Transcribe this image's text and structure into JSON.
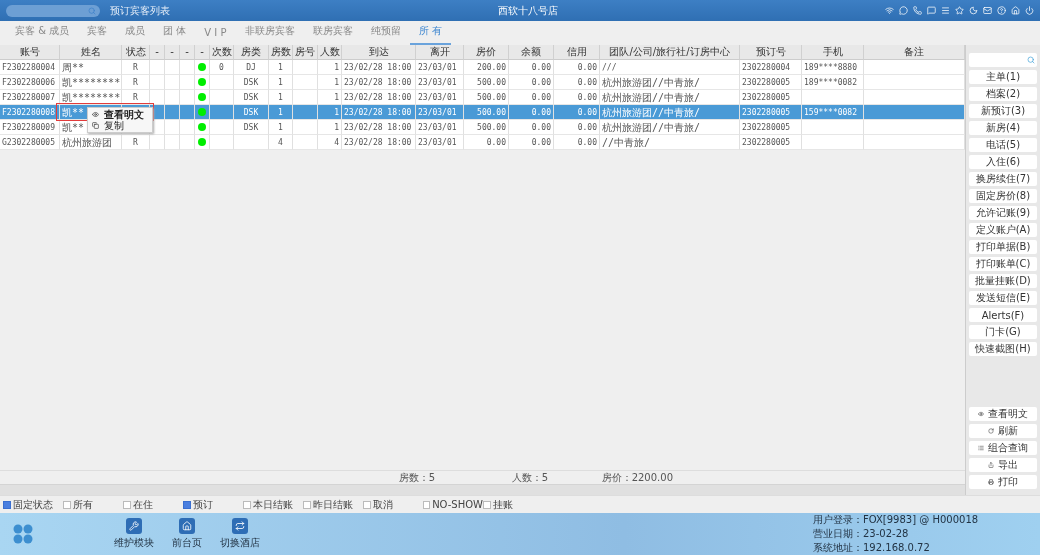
{
  "top_bar": {
    "page_title": "预订宾客列表",
    "hotel": "西软十八号店"
  },
  "tabs": [
    {
      "label": "宾客 & 成员",
      "selected": false
    },
    {
      "label": "宾客",
      "selected": false
    },
    {
      "label": "成员",
      "selected": false
    },
    {
      "label": "团 体",
      "selected": false
    },
    {
      "label": "V I P",
      "selected": false
    },
    {
      "label": "非联房宾客",
      "selected": false
    },
    {
      "label": "联房宾客",
      "selected": false
    },
    {
      "label": "纯预留",
      "selected": false
    },
    {
      "label": "所 有",
      "selected": true
    }
  ],
  "table": {
    "columns": [
      {
        "label": "账号",
        "kind": "text"
      },
      {
        "label": "姓名",
        "kind": "text"
      },
      {
        "label": "状态",
        "kind": "center"
      },
      {
        "label": "-",
        "kind": "center"
      },
      {
        "label": "-",
        "kind": "center"
      },
      {
        "label": "-",
        "kind": "center"
      },
      {
        "label": "-",
        "kind": "dot"
      },
      {
        "label": "次数",
        "kind": "center"
      },
      {
        "label": "房类",
        "kind": "center"
      },
      {
        "label": "房数",
        "kind": "center"
      },
      {
        "label": "房号",
        "kind": "center"
      },
      {
        "label": "人数",
        "kind": "right"
      },
      {
        "label": "到达",
        "kind": "text"
      },
      {
        "label": "离开",
        "kind": "text"
      },
      {
        "label": "房价",
        "kind": "right"
      },
      {
        "label": "余额",
        "kind": "right"
      },
      {
        "label": "信用",
        "kind": "right"
      },
      {
        "label": "团队/公司/旅行社/订房中心",
        "kind": "text"
      },
      {
        "label": "预订号",
        "kind": "text"
      },
      {
        "label": "手机",
        "kind": "text"
      },
      {
        "label": "备注",
        "kind": "text"
      }
    ],
    "rows": [
      {
        "selected": false,
        "color": "#00ee00",
        "cells": [
          "F2302280004",
          "周**",
          "R",
          null,
          null,
          null,
          null,
          "0",
          "DJ",
          "1",
          null,
          "1",
          "23/02/28 18:00",
          "23/03/01",
          "200.00",
          "0.00",
          "0.00",
          "///",
          "2302280004",
          "189****8880",
          null
        ]
      },
      {
        "selected": false,
        "color": "#00ee00",
        "cells": [
          "F2302280006",
          "凯********",
          "R",
          null,
          null,
          null,
          null,
          null,
          "DSK",
          "1",
          null,
          "1",
          "23/02/28 18:00",
          "23/03/01",
          "500.00",
          "0.00",
          "0.00",
          "杭州旅游团//中青旅/",
          "2302280005",
          "189****0082",
          null
        ]
      },
      {
        "selected": false,
        "color": "#00ee00",
        "cells": [
          "F2302280007",
          "凯********",
          "R",
          null,
          null,
          null,
          null,
          null,
          "DSK",
          "1",
          null,
          "1",
          "23/02/28 18:00",
          "23/03/01",
          "500.00",
          "0.00",
          "0.00",
          "杭州旅游团//中青旅/",
          "2302280005",
          null,
          null
        ]
      },
      {
        "selected": true,
        "color": "#00ee00",
        "cells": [
          "F2302280008",
          "凯**",
          null,
          null,
          null,
          null,
          null,
          null,
          "DSK",
          "1",
          null,
          "1",
          "23/02/28 18:00",
          "23/03/01",
          "500.00",
          "0.00",
          "0.00",
          "杭州旅游团//中青旅/",
          "2302280005",
          "159****0082",
          null
        ]
      },
      {
        "selected": false,
        "color": "#00ee00",
        "cells": [
          "F2302280009",
          "凯**",
          null,
          null,
          null,
          null,
          null,
          null,
          "DSK",
          "1",
          null,
          "1",
          "23/02/28 18:00",
          "23/03/01",
          "500.00",
          "0.00",
          "0.00",
          "杭州旅游团//中青旅/",
          "2302280005",
          null,
          null
        ]
      },
      {
        "selected": false,
        "color": "#00ee00",
        "cells": [
          "G2302280005",
          "杭州旅游团",
          "R",
          null,
          null,
          null,
          null,
          null,
          null,
          "4",
          null,
          "4",
          "23/02/28 18:00",
          "23/03/01",
          "0.00",
          "0.00",
          "0.00",
          "//中青旅/",
          "2302280005",
          null,
          null
        ]
      }
    ],
    "context_menu": [
      {
        "label": "查看明文",
        "selected": true
      },
      {
        "label": "复制",
        "selected": false
      }
    ],
    "summary": {
      "rooms": "房数：5",
      "people": "人数：5",
      "rate": "房价：2200.00"
    }
  },
  "side_buttons": [
    "主单(1)",
    "档案(2)",
    "新预订(3)",
    "新房(4)",
    "电话(5)",
    "入住(6)",
    "换房续住(7)",
    "固定房价(8)",
    "允许记账(9)",
    "定义账户(A)",
    "打印单据(B)",
    "打印账单(C)",
    "批量挂账(D)",
    "发送短信(E)",
    "Alerts(F)",
    "门卡(G)",
    "快速截图(H)"
  ],
  "side_actions": [
    {
      "label": "查看明文",
      "kind": "eye"
    },
    {
      "label": "刷新",
      "kind": "refresh"
    },
    {
      "label": "组合查询",
      "kind": "list"
    },
    {
      "label": "导出",
      "kind": "export"
    },
    {
      "label": "打印",
      "kind": "print"
    }
  ],
  "filters": [
    {
      "label": "固定状态",
      "checked": true
    },
    {
      "label": "所有",
      "checked": false
    },
    {
      "label": "在住",
      "checked": false
    },
    {
      "label": "预订",
      "checked": true
    },
    {
      "label": "本日结账",
      "checked": false
    },
    {
      "label": "昨日结账",
      "checked": false
    },
    {
      "label": "取消",
      "checked": false
    },
    {
      "label": "NO-SHOW",
      "checked": false
    },
    {
      "label": "挂账",
      "checked": false
    }
  ],
  "footer": {
    "modules": [
      {
        "label": "维护模块",
        "kind": "wrench"
      },
      {
        "label": "前台页",
        "kind": "home"
      },
      {
        "label": "切换酒店",
        "kind": "switch"
      }
    ],
    "info": [
      "用户登录：FOX[9983] @ H000018",
      "营业日期：23-02-28",
      "系统地址：192.168.0.72"
    ]
  }
}
